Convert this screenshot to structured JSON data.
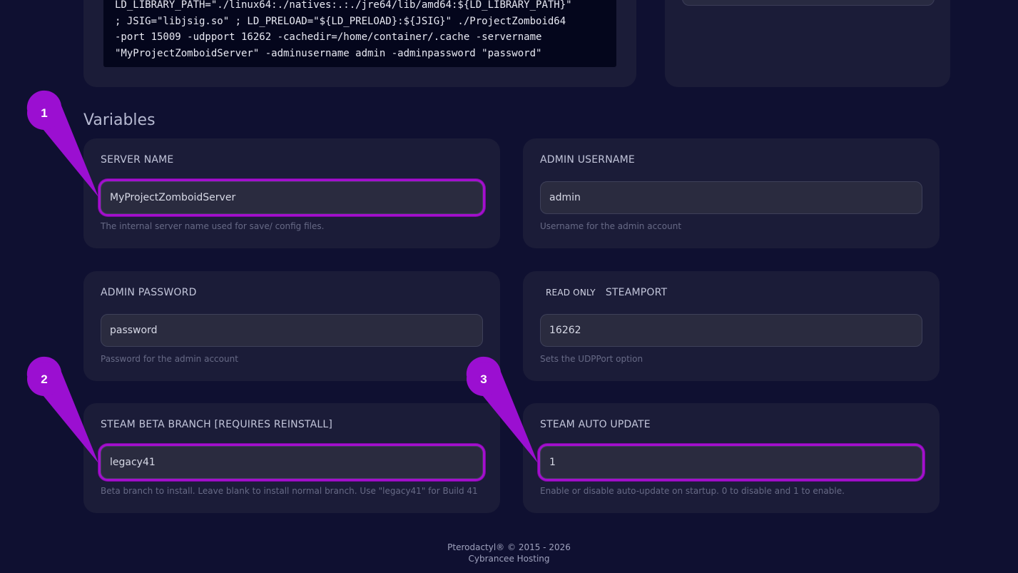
{
  "startup": {
    "command_lines": [
      "LD_LIBRARY_PATH=\"./linux64:./natives:.:./jre64/lib/amd64:${LD_LIBRARY_PATH}\"",
      "; JSIG=\"libjsig.so\" ; LD_PRELOAD=\"${LD_PRELOAD}:${JSIG}\" ./ProjectZomboid64",
      "-port 15009 -udpport 16262 -cachedir=/home/container/.cache -servername",
      "\"MyProjectZomboidServer\" -adminusername admin -adminpassword \"password\""
    ]
  },
  "variables": {
    "title": "Variables",
    "items": [
      {
        "label": "SERVER NAME",
        "value": "MyProjectZomboidServer",
        "description": "The internal server name used for save/ config files.",
        "badge": ""
      },
      {
        "label": "ADMIN USERNAME",
        "value": "admin",
        "description": "Username for the admin account",
        "badge": ""
      },
      {
        "label": "ADMIN PASSWORD",
        "value": "password",
        "description": "Password for the admin account",
        "badge": ""
      },
      {
        "label": "STEAMPORT",
        "value": "16262",
        "description": "Sets the UDPPort option",
        "badge": "READ ONLY"
      },
      {
        "label": "STEAM BETA BRANCH [REQUIRES REINSTALL]",
        "value": "legacy41",
        "description": "Beta branch to install. Leave blank to install normal branch. Use \"legacy41\" for Build 41",
        "badge": ""
      },
      {
        "label": "STEAM AUTO UPDATE",
        "value": "1",
        "description": "Enable or disable auto-update on startup. 0 to disable and 1 to enable.",
        "badge": ""
      }
    ]
  },
  "annotations": {
    "markers": [
      "1",
      "2",
      "3"
    ],
    "color": "#9b0fd1"
  },
  "footer": {
    "line1": "Pterodactyl® © 2015 - 2026",
    "line2": "Cybrancee Hosting"
  },
  "theme": {
    "background": "#0f1031",
    "card": "#1b1c38",
    "input": "#2a2b3f",
    "highlight": "#a40fce"
  }
}
